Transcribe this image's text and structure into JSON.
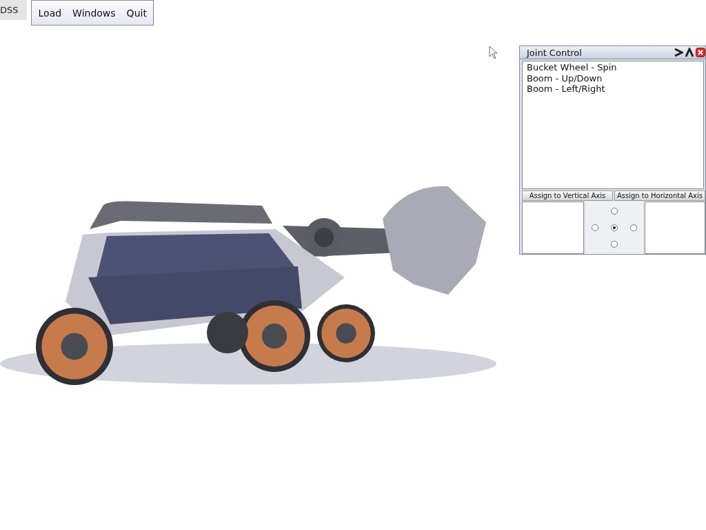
{
  "app_label": "DSS",
  "menu": [
    {
      "label": "Load"
    },
    {
      "label": "Windows"
    },
    {
      "label": "Quit"
    }
  ],
  "joint_control": {
    "title": "Joint Control",
    "joints": [
      {
        "label": "Bucket Wheel - Spin"
      },
      {
        "label": "Boom - Up/Down"
      },
      {
        "label": "Boom - Left/Right"
      }
    ],
    "buttons": [
      {
        "label": "Assign to Vertical Axis"
      },
      {
        "label": "Assign to Horizontal Axis"
      }
    ],
    "directions": [
      {
        "kind": "up",
        "selected": false
      },
      {
        "kind": "left",
        "selected": false
      },
      {
        "kind": "center",
        "selected": true
      },
      {
        "kind": "right",
        "selected": false
      },
      {
        "kind": "down",
        "selected": false
      }
    ]
  }
}
